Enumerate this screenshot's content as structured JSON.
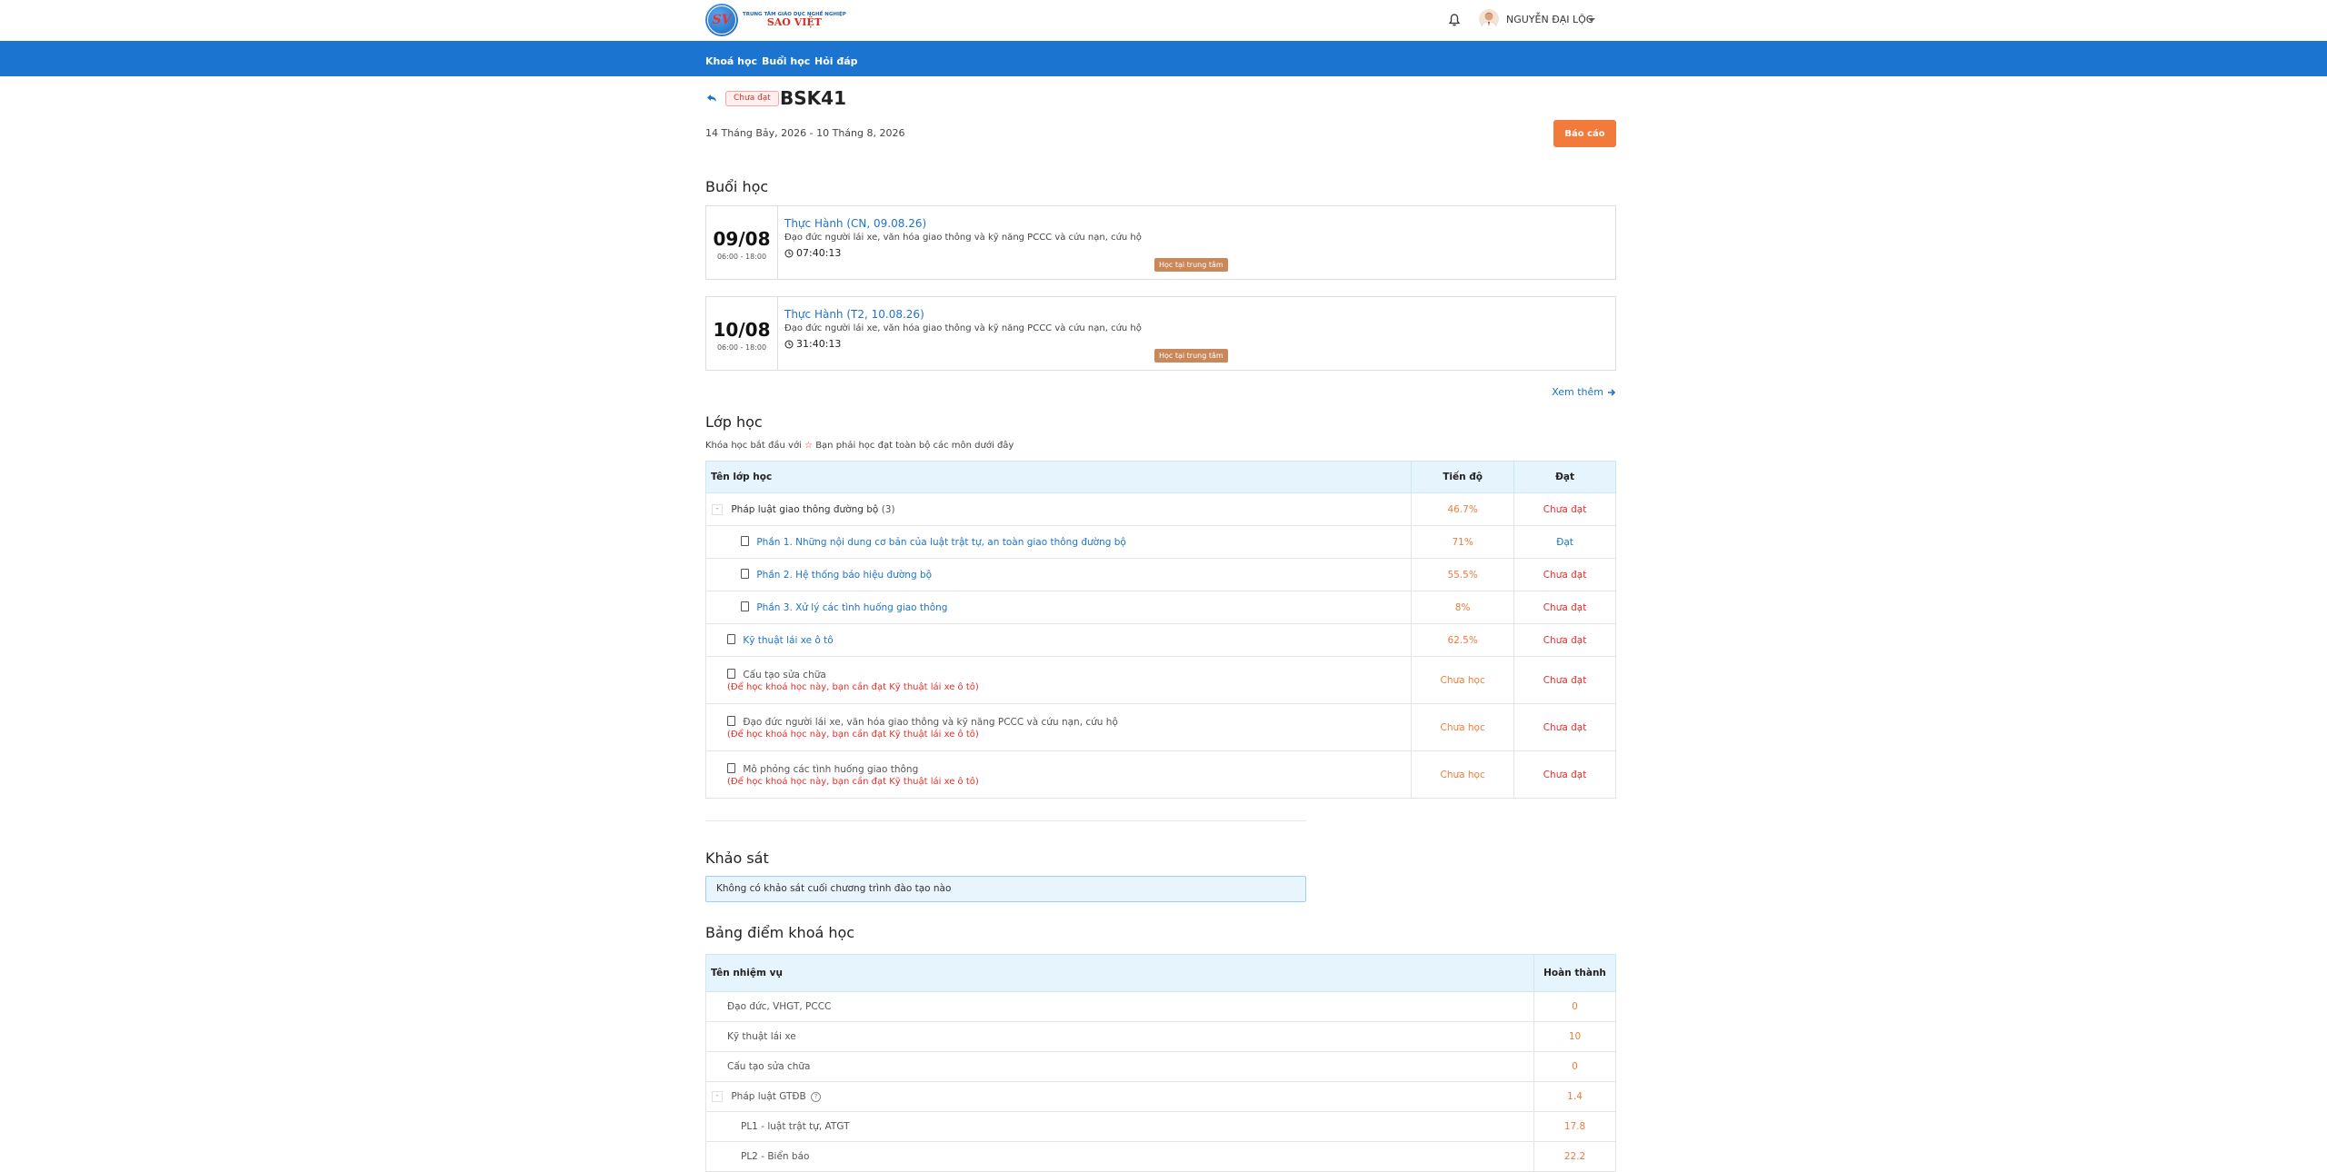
{
  "brand": {
    "line1": "TRUNG TÂM GIÁO DỤC NGHỀ NGHIỆP",
    "line2": "SAO VIỆT",
    "badge": "SV",
    "accent_color": "#1b75d0",
    "orange": "#f27a3b"
  },
  "header": {
    "user_name": "NGUYỄN ĐẠI LỘC",
    "bell_icon": "bell-icon",
    "caret_icon": "caret-down-icon"
  },
  "nav": {
    "items": [
      "Khoá học",
      "Buổi học",
      "Hỏi đáp"
    ]
  },
  "course": {
    "status": "Chưa đạt",
    "code": "BSK41",
    "date_range": "14 Tháng Bảy, 2026 - 10 Tháng 8, 2026",
    "report_label": "Báo cáo"
  },
  "sessions": {
    "title": "Buổi học",
    "items": [
      {
        "day": "09/08",
        "time": "06:00 - 18:00",
        "title": "Thực Hành (CN, 09.08.26)",
        "desc": "Đạo đức người lái xe, văn hóa giao thông và kỹ năng PCCC và cứu nạn, cứu hộ",
        "duration": "07:40:13",
        "badge": "Học tại trung tâm"
      },
      {
        "day": "10/08",
        "time": "06:00 - 18:00",
        "title": "Thực Hành (T2, 10.08.26)",
        "desc": "Đạo đức người lái xe, văn hóa giao thông và kỹ năng PCCC và cứu nạn, cứu hộ",
        "duration": "31:40:13",
        "badge": "Học tại trung tâm"
      }
    ],
    "see_more": "Xem thêm"
  },
  "classes": {
    "title": "Lớp học",
    "note_before": "Khóa học bắt đầu với",
    "note_after": "Bạn phải học đạt toàn bộ các môn dưới đây",
    "headers": {
      "name": "Tên lớp học",
      "progress": "Tiến độ",
      "pass": "Đạt"
    },
    "group": {
      "name": "Pháp luật giao thông đường bộ",
      "count": "(3)",
      "progress": "46.7%",
      "pass": "Chưa đạt",
      "toggle": "-"
    },
    "group_rows": [
      {
        "name": "Phần 1. Những nội dung cơ bản của luật trật tự, an toàn giao thông đường bộ",
        "progress": "71%",
        "pass": "Đạt"
      },
      {
        "name": "Phần 2. Hệ thống báo hiệu đường bộ",
        "progress": "55.5%",
        "pass": "Chưa đạt"
      },
      {
        "name": "Phần 3. Xử lý các tình huống giao thông",
        "progress": "8%",
        "pass": "Chưa đạt"
      }
    ],
    "single": {
      "name": "Kỹ thuật lái xe ô tô",
      "progress": "62.5%",
      "pass": "Chưa đạt"
    },
    "locked_rows": [
      {
        "name": "Cấu tạo sửa chữa",
        "req": "(Để học khoá học này, bạn cần đạt Kỹ thuật lái xe ô tô)",
        "progress": "Chưa học",
        "pass": "Chưa đạt"
      },
      {
        "name": "Đạo đức người lái xe, văn hóa giao thông và kỹ năng PCCC và cứu nạn, cứu hộ",
        "req": "(Để học khoá học này, bạn cần đạt Kỹ thuật lái xe ô tô)",
        "progress": "Chưa học",
        "pass": "Chưa đạt"
      },
      {
        "name": "Mô phỏng các tình huống giao thông",
        "req": "(Để học khoá học này, bạn cần đạt Kỹ thuật lái xe ô tô)",
        "progress": "Chưa học",
        "pass": "Chưa đạt"
      }
    ]
  },
  "survey": {
    "title": "Khảo sát",
    "message": "Không có khảo sát cuối chương trình đào tạo nào"
  },
  "scores": {
    "title": "Bảng điểm khoá học",
    "headers": {
      "task": "Tên nhiệm vụ",
      "done": "Hoàn thành"
    },
    "rows": [
      {
        "name": "Đạo đức, VHGT, PCCC",
        "value": "0"
      },
      {
        "name": "Kỹ thuật lái xe",
        "value": "10"
      },
      {
        "name": "Cấu tạo sửa chữa",
        "value": "0"
      }
    ],
    "group": {
      "name": "Pháp luật GTĐB",
      "value": "1.4",
      "toggle": "-",
      "help": "?"
    },
    "sub_rows": [
      {
        "name": "PL1 - luật trật tự, ATGT",
        "value": "17.8"
      },
      {
        "name": "PL2 - Biển báo",
        "value": "22.2"
      }
    ]
  }
}
